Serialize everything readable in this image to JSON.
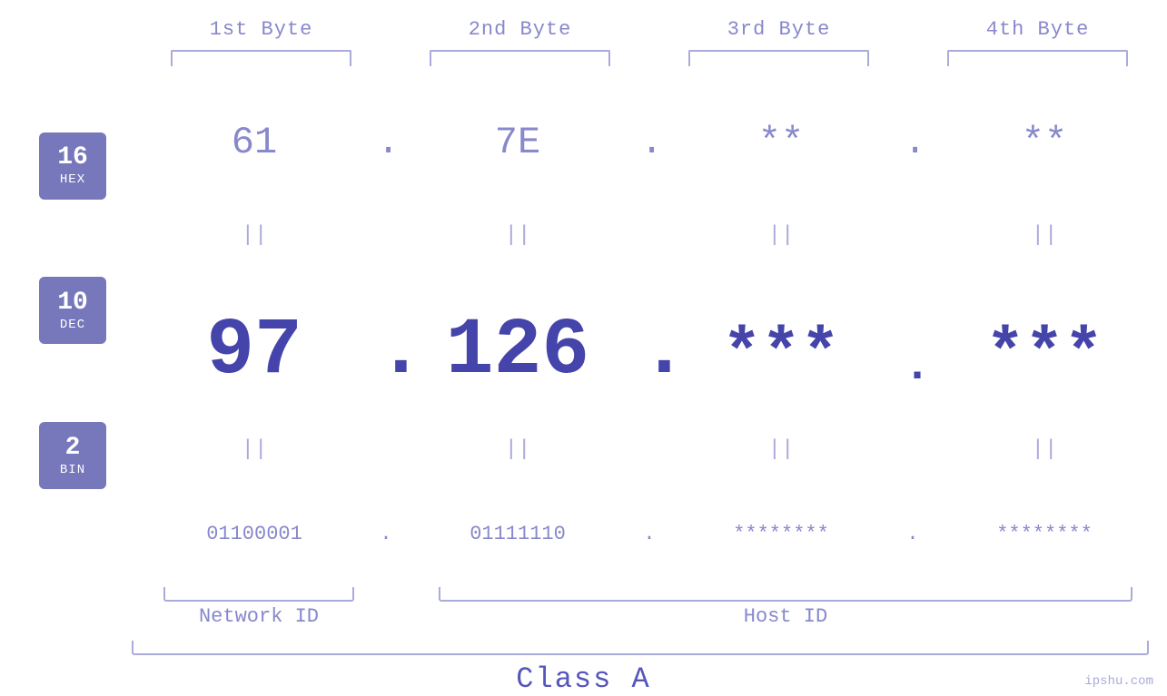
{
  "header": {
    "bytes": [
      "1st Byte",
      "2nd Byte",
      "3rd Byte",
      "4th Byte"
    ]
  },
  "badges": [
    {
      "num": "16",
      "label": "HEX"
    },
    {
      "num": "10",
      "label": "DEC"
    },
    {
      "num": "2",
      "label": "BIN"
    }
  ],
  "hex_values": [
    "61",
    "7E",
    "**",
    "**"
  ],
  "dec_values": [
    "97",
    "126",
    "***",
    "***"
  ],
  "bin_values": [
    "01100001",
    "01111110",
    "********",
    "********"
  ],
  "dots_hex": [
    ".",
    ".",
    "."
  ],
  "dots_dec": [
    ".",
    ".",
    "."
  ],
  "dots_bin": [
    ".",
    ".",
    "."
  ],
  "labels": {
    "network_id": "Network ID",
    "host_id": "Host ID",
    "class": "Class A",
    "watermark": "ipshu.com"
  },
  "equals": [
    "||",
    "||",
    "||",
    "||"
  ]
}
